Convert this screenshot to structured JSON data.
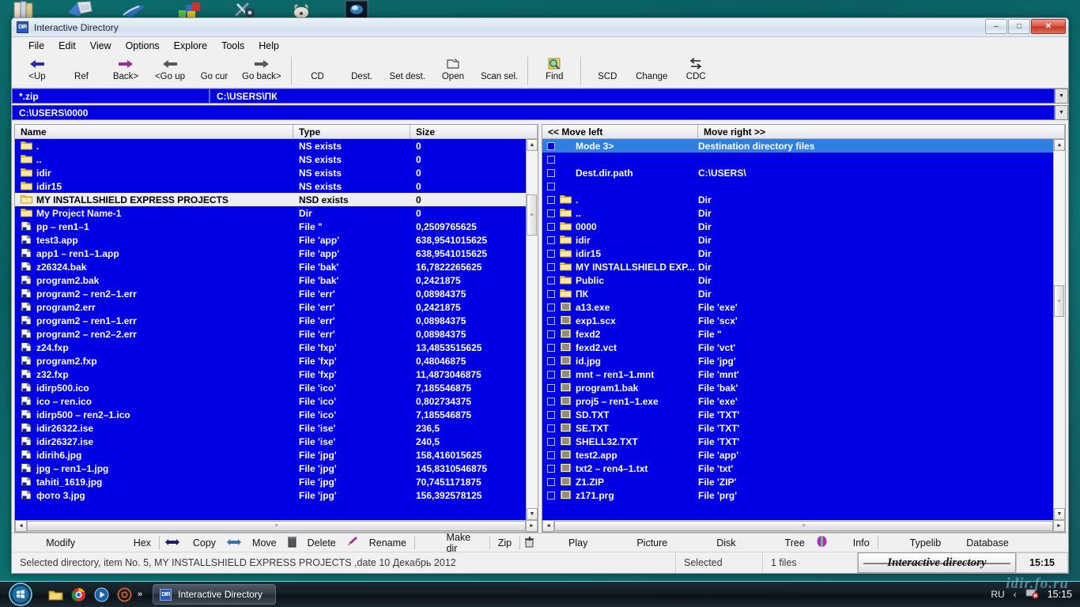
{
  "window": {
    "title": "Interactive Directory",
    "app_badge": "DIR",
    "minimize": "–",
    "maximize": "□",
    "close": "✕"
  },
  "menu": {
    "items": [
      {
        "label": "File"
      },
      {
        "label": "Edit"
      },
      {
        "label": "View"
      },
      {
        "label": "Options"
      },
      {
        "label": "Explore"
      },
      {
        "label": "Tools"
      },
      {
        "label": "Help"
      }
    ]
  },
  "toolbar": {
    "group1": [
      {
        "label": "<Up",
        "icon": "arrow-left-blue-icon"
      },
      {
        "label": "Ref",
        "icon": "none"
      },
      {
        "label": "Back>",
        "icon": "arrow-right-purple-icon"
      },
      {
        "label": "<Go up",
        "icon": "arrow-left-gray-icon"
      },
      {
        "label": "Go cur",
        "icon": "none"
      },
      {
        "label": "Go back>",
        "icon": "arrow-right-gray-icon"
      }
    ],
    "group2": [
      {
        "label": "CD",
        "icon": "none"
      },
      {
        "label": "Dest.",
        "icon": "none"
      },
      {
        "label": "Set dest.",
        "icon": "none"
      },
      {
        "label": "Open",
        "icon": "folder-open-icon"
      },
      {
        "label": "Scan sel.",
        "icon": "none"
      }
    ],
    "group3": [
      {
        "label": "Find",
        "icon": "magnifier-icon"
      }
    ],
    "group4": [
      {
        "label": "SCD",
        "icon": "none"
      },
      {
        "label": "Change",
        "icon": "none"
      },
      {
        "label": "CDC",
        "icon": "swap-arrows-icon"
      }
    ]
  },
  "filter_bar": {
    "mask_value": "*.zip",
    "path_value": "C:\\USERS\\ПК",
    "dropdown_icon": "chevron-down-icon"
  },
  "path_bar": {
    "value": "C:\\USERS\\0000",
    "dropdown_icon": "chevron-down-icon"
  },
  "left_pane": {
    "columns": [
      "Name",
      "Type",
      "Size"
    ],
    "selected_index": 4,
    "rows": [
      {
        "icon": "folder-icon",
        "name": ".",
        "type": "NS exists",
        "size": "0"
      },
      {
        "icon": "folder-icon",
        "name": "..",
        "type": "NS exists",
        "size": "0"
      },
      {
        "icon": "folder-icon",
        "name": "idir",
        "type": "NS exists",
        "size": "0"
      },
      {
        "icon": "folder-icon",
        "name": "idir15",
        "type": "NS exists",
        "size": "0"
      },
      {
        "icon": "folder-icon",
        "name": "MY INSTALLSHIELD EXPRESS PROJECTS",
        "type": "NSD exists",
        "size": "0"
      },
      {
        "icon": "folder-icon",
        "name": "My Project Name-1",
        "type": "Dir",
        "size": "0"
      },
      {
        "icon": "file-icon",
        "name": "pp – ren1–1",
        "type": "File \"",
        "size": "0,2509765625"
      },
      {
        "icon": "file-icon",
        "name": "test3.app",
        "type": "File 'app'",
        "size": "638,9541015625"
      },
      {
        "icon": "file-icon",
        "name": "app1 – ren1–1.app",
        "type": "File 'app'",
        "size": "638,9541015625"
      },
      {
        "icon": "file-icon",
        "name": "z26324.bak",
        "type": "File 'bak'",
        "size": "16,7822265625"
      },
      {
        "icon": "file-icon",
        "name": "program2.bak",
        "type": "File 'bak'",
        "size": "0,2421875"
      },
      {
        "icon": "file-icon",
        "name": "program2 – ren2–1.err",
        "type": "File 'err'",
        "size": "0,08984375"
      },
      {
        "icon": "file-icon",
        "name": "program2.err",
        "type": "File 'err'",
        "size": "0,2421875"
      },
      {
        "icon": "file-icon",
        "name": "program2 – ren1–1.err",
        "type": "File 'err'",
        "size": "0,08984375"
      },
      {
        "icon": "file-icon",
        "name": "program2 – ren2–2.err",
        "type": "File 'err'",
        "size": "0,08984375"
      },
      {
        "icon": "file-icon",
        "name": "z24.fxp",
        "type": "File 'fxp'",
        "size": "13,4853515625"
      },
      {
        "icon": "file-icon",
        "name": "program2.fxp",
        "type": "File 'fxp'",
        "size": "0,48046875"
      },
      {
        "icon": "file-icon",
        "name": "z32.fxp",
        "type": "File 'fxp'",
        "size": "11,4873046875"
      },
      {
        "icon": "file-icon",
        "name": "idirp500.ico",
        "type": "File 'ico'",
        "size": "7,185546875"
      },
      {
        "icon": "file-icon",
        "name": "ico – ren.ico",
        "type": "File 'ico'",
        "size": "0,802734375"
      },
      {
        "icon": "file-icon",
        "name": "idirp500 – ren2–1.ico",
        "type": "File 'ico'",
        "size": "7,185546875"
      },
      {
        "icon": "file-icon",
        "name": "idir26322.ise",
        "type": "File 'ise'",
        "size": "236,5"
      },
      {
        "icon": "file-icon",
        "name": "idir26327.ise",
        "type": "File 'ise'",
        "size": "240,5"
      },
      {
        "icon": "file-icon",
        "name": "idirih6.jpg",
        "type": "File 'jpg'",
        "size": "158,416015625"
      },
      {
        "icon": "file-icon",
        "name": "jpg – ren1–1.jpg",
        "type": "File 'jpg'",
        "size": "145,8310546875"
      },
      {
        "icon": "file-icon",
        "name": "tahiti_1619.jpg",
        "type": "File 'jpg'",
        "size": "70,7451171875"
      },
      {
        "icon": "file-icon",
        "name": "фото 3.jpg",
        "type": "File 'jpg'",
        "size": "156,392578125"
      }
    ]
  },
  "right_pane": {
    "columns": [
      "<< Move left",
      "Move right >>"
    ],
    "highlight_index": 0,
    "rows": [
      {
        "icon": "none",
        "name": "Mode 3>",
        "type": "Destination directory files",
        "checkbox": true,
        "highlight": true
      },
      {
        "icon": "none",
        "name": "",
        "type": "",
        "checkbox": true
      },
      {
        "icon": "none",
        "name": "Dest.dir.path",
        "type": "C:\\USERS\\",
        "checkbox": true
      },
      {
        "icon": "none",
        "name": "",
        "type": "",
        "checkbox": true
      },
      {
        "icon": "folder-icon",
        "name": ".",
        "type": "Dir",
        "checkbox": true
      },
      {
        "icon": "folder-icon",
        "name": "..",
        "type": "Dir",
        "checkbox": true
      },
      {
        "icon": "folder-icon",
        "name": "0000",
        "type": "Dir",
        "checkbox": true
      },
      {
        "icon": "folder-icon",
        "name": "idir",
        "type": "Dir",
        "checkbox": true
      },
      {
        "icon": "folder-icon",
        "name": "idir15",
        "type": "Dir",
        "checkbox": true
      },
      {
        "icon": "folder-icon",
        "name": "MY INSTALLSHIELD EXP...",
        "type": "Dir",
        "checkbox": true
      },
      {
        "icon": "folder-icon",
        "name": "Public",
        "type": "Dir",
        "checkbox": true
      },
      {
        "icon": "folder-icon",
        "name": "ПК",
        "type": "Dir",
        "checkbox": true
      },
      {
        "icon": "doc-icon",
        "name": "a13.exe",
        "type": "File 'exe'",
        "checkbox": true
      },
      {
        "icon": "doc-icon",
        "name": "exp1.scx",
        "type": "File 'scx'",
        "checkbox": true
      },
      {
        "icon": "doc-icon",
        "name": "fexd2",
        "type": "File \"",
        "checkbox": true
      },
      {
        "icon": "doc-icon",
        "name": "fexd2.vct",
        "type": "File 'vct'",
        "checkbox": true
      },
      {
        "icon": "doc-icon",
        "name": "id.jpg",
        "type": "File 'jpg'",
        "checkbox": true
      },
      {
        "icon": "doc-icon",
        "name": "mnt – ren1–1.mnt",
        "type": "File 'mnt'",
        "checkbox": true
      },
      {
        "icon": "doc-icon",
        "name": "program1.bak",
        "type": "File 'bak'",
        "checkbox": true
      },
      {
        "icon": "doc-icon",
        "name": "proj5 – ren1–1.exe",
        "type": "File 'exe'",
        "checkbox": true
      },
      {
        "icon": "doc-icon",
        "name": "SD.TXT",
        "type": "File 'TXT'",
        "checkbox": true
      },
      {
        "icon": "doc-icon",
        "name": "SE.TXT",
        "type": "File 'TXT'",
        "checkbox": true
      },
      {
        "icon": "doc-icon",
        "name": "SHELL32.TXT",
        "type": "File 'TXT'",
        "checkbox": true
      },
      {
        "icon": "doc-icon",
        "name": "test2.app",
        "type": "File 'app'",
        "checkbox": true
      },
      {
        "icon": "doc-icon",
        "name": "txt2 – ren4–1.txt",
        "type": "File 'txt'",
        "checkbox": true
      },
      {
        "icon": "doc-icon",
        "name": "Z1.ZIP",
        "type": "File 'ZIP'",
        "checkbox": true
      },
      {
        "icon": "doc-icon",
        "name": "z171.prg",
        "type": "File 'prg'",
        "checkbox": true
      }
    ]
  },
  "command_bar": {
    "left": [
      {
        "label": "Modify",
        "icon": "none"
      },
      {
        "label": "Hex",
        "icon": "none"
      },
      {
        "label": "Copy",
        "icon": "copy-arrows-icon",
        "icon_before": "diamond-arrows-icon"
      },
      {
        "label": "Move",
        "icon": "move-arrows-icon"
      },
      {
        "label": "Delete",
        "icon": "trash-icon"
      },
      {
        "label": "Rename",
        "icon": "rename-pen-icon"
      },
      {
        "label": "Make dir",
        "icon": "none"
      },
      {
        "label": "Zip",
        "icon": "zip-icon"
      }
    ],
    "right": [
      {
        "label": "Play",
        "icon": "none"
      },
      {
        "label": "Picture",
        "icon": "none"
      },
      {
        "label": "Disk",
        "icon": "none"
      },
      {
        "label": "Tree",
        "icon": "tree-gem-icon"
      },
      {
        "label": "Info",
        "icon": "none"
      },
      {
        "label": "Typelib",
        "icon": "none"
      },
      {
        "label": "Database",
        "icon": "none"
      }
    ]
  },
  "status_bar": {
    "main": "Selected directory, item No. 5, MY INSTALLSHIELD EXPRESS PROJECTS ,date 10 Декабрь 2012",
    "selected_label": "Selected",
    "files_count": "1 files",
    "brand": "Interactive directory",
    "time": "15:15"
  },
  "taskbar": {
    "start_icon": "windows-orb-icon",
    "quick_launch": [
      {
        "icon": "folder-explorer-icon"
      },
      {
        "icon": "chrome-icon"
      },
      {
        "icon": "media-player-icon"
      },
      {
        "icon": "at-sign-icon"
      }
    ],
    "overflow_icon": "double-chevron-right-icon",
    "task_button": {
      "label": "Interactive Directory",
      "badge": "DIR"
    },
    "tray": {
      "language": "RU",
      "show_hidden_icon": "chevron-left-icon",
      "network_icon": "network-error-icon",
      "time": "15:15"
    }
  },
  "watermark": {
    "text": "idir.fo.ru"
  }
}
